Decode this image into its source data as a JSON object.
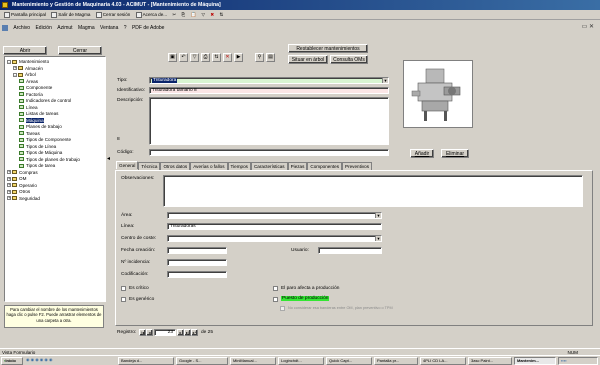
{
  "window": {
    "title": "Mantenimiento y Gestión de Maquinaria 4.03 - ACIMUT - [Mantenimiento de Máquina]"
  },
  "toolbar": {
    "items": [
      "Pantalla principal",
      "Salir de Magma",
      "Cerrar sesión",
      "Acerca de..."
    ]
  },
  "menu": {
    "items": [
      "Archivo",
      "Edición",
      "Azimut",
      "Magma",
      "Ventana",
      "?",
      "PDF de Adobe"
    ]
  },
  "left_buttons": {
    "open": "Abrir",
    "close": "Cerrar"
  },
  "tree": {
    "items": [
      {
        "label": "Mantenimiento",
        "indent": 0,
        "kind": "folder",
        "expander": "-"
      },
      {
        "label": "Almacén",
        "indent": 1,
        "kind": "folder",
        "expander": "+"
      },
      {
        "label": "Árbol",
        "indent": 1,
        "kind": "folder",
        "expander": "-"
      },
      {
        "label": "Áreas",
        "indent": 2,
        "kind": "check"
      },
      {
        "label": "Componente",
        "indent": 2,
        "kind": "check"
      },
      {
        "label": "Factoría",
        "indent": 2,
        "kind": "check"
      },
      {
        "label": "Indicadores de control",
        "indent": 2,
        "kind": "check"
      },
      {
        "label": "Línea",
        "indent": 2,
        "kind": "check"
      },
      {
        "label": "Listas de tareas",
        "indent": 2,
        "kind": "check"
      },
      {
        "label": "Máquina",
        "indent": 2,
        "kind": "check",
        "selected": true
      },
      {
        "label": "Planes de trabajo",
        "indent": 2,
        "kind": "check"
      },
      {
        "label": "Tareas",
        "indent": 2,
        "kind": "check"
      },
      {
        "label": "Tipos de Componente",
        "indent": 2,
        "kind": "check"
      },
      {
        "label": "Tipos de Línea",
        "indent": 2,
        "kind": "check"
      },
      {
        "label": "Tipos de Máquina",
        "indent": 2,
        "kind": "check"
      },
      {
        "label": "Tipos de planes de trabajo",
        "indent": 2,
        "kind": "check"
      },
      {
        "label": "Tipos de tarea",
        "indent": 2,
        "kind": "check"
      },
      {
        "label": "Compras",
        "indent": 0,
        "kind": "folder",
        "expander": "+"
      },
      {
        "label": "OM",
        "indent": 0,
        "kind": "folder",
        "expander": "+"
      },
      {
        "label": "Operario",
        "indent": 0,
        "kind": "folder",
        "expander": "+"
      },
      {
        "label": "Otros",
        "indent": 0,
        "kind": "folder",
        "expander": "+"
      },
      {
        "label": "Seguridad",
        "indent": 0,
        "kind": "folder",
        "expander": "+"
      }
    ]
  },
  "help": {
    "text": "Para cambiar el nombre de los mantenimientos haga clic o pulse F2. Puede arrastrar elementos de una carpeta a otra."
  },
  "header_buttons": {
    "restore": "Restablecer mantenimientos",
    "tree": "Situar en árbol",
    "consult": "Consulta OMs"
  },
  "form": {
    "tipo_label": "Tipo:",
    "tipo_value": "Trituradora",
    "ident_label": "Identificativo:",
    "ident_value": "Trituradora tamaño 8",
    "desc_label": "Descripción:",
    "counter": "8",
    "codigo_label": "Código:",
    "codigo_value": ""
  },
  "image_buttons": {
    "add": "Añadir",
    "delete": "Eliminar"
  },
  "tabs": [
    "General",
    "Técnica",
    "Otros datos",
    "Averías o fallos",
    "Tiempos",
    "Características",
    "Piezas",
    "Componentes",
    "Preventivos"
  ],
  "general": {
    "observ_label": "Observaciones:",
    "area_label": "Área:",
    "area_value": "",
    "linea_label": "Línea:",
    "linea_value": "Trituradoras",
    "centro_label": "Centro de coste:",
    "centro_value": "",
    "fecha_label": "Fecha creación:",
    "fecha_value": "",
    "usuario_label": "Usuario:",
    "usuario_value": "",
    "incid_label": "Nº incidencia:",
    "incid_value": "",
    "codif_label": "Codificación:",
    "codif_value": "",
    "critico_label": "Es crítico",
    "generico_label": "Es genérico",
    "paro_label": "El paro afecta a producción",
    "puesto_label": "Puesto de producción",
    "note": "No considerar esa banderas entre OM, plan preventivo o TPM"
  },
  "record": {
    "label": "Registro:",
    "value": "23",
    "total_label": "de 25"
  },
  "status": {
    "text": "Vista Formulario",
    "num": "NUM"
  },
  "taskbar": {
    "start": "Inicio",
    "tasks": [
      "Bandeja d...",
      "Google - S...",
      "MiniManual...",
      "Loginchdt...",
      "Quick Capt...",
      "Pantalla pr...",
      "4PLI CD LA...",
      "3asc Paint...",
      "Mantenim..."
    ]
  }
}
